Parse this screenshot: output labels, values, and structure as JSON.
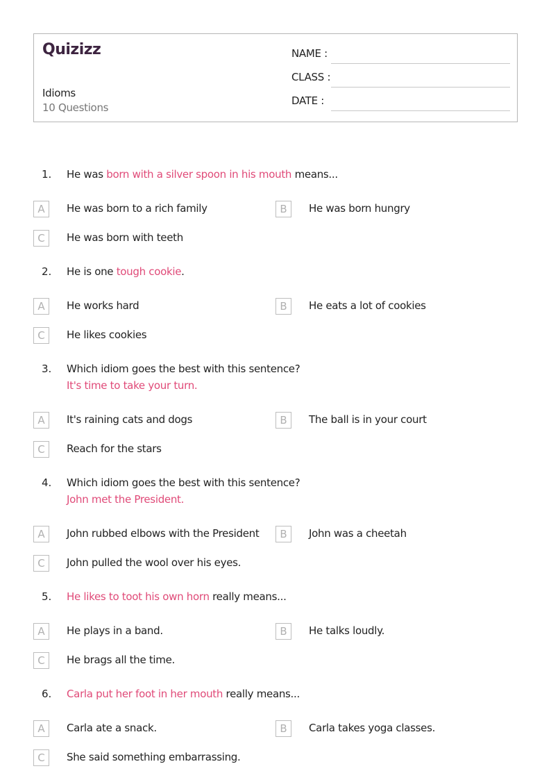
{
  "header": {
    "logo": "Quizizz",
    "title": "Idioms",
    "question_count": "10 Questions",
    "fields": {
      "name_label": "NAME :",
      "class_label": "CLASS :",
      "date_label": "DATE  :"
    }
  },
  "questions": [
    {
      "number": "1.",
      "parts": {
        "pre": "He was ",
        "highlight": "born with a silver spoon in his mouth",
        "post": " means..."
      },
      "options": [
        {
          "letter": "A",
          "text": "He was born to a rich family"
        },
        {
          "letter": "B",
          "text": "He was born hungry"
        },
        {
          "letter": "C",
          "text": "He was born with teeth"
        }
      ]
    },
    {
      "number": "2.",
      "parts": {
        "pre": "He is one ",
        "highlight": "tough cookie",
        "post": "."
      },
      "options": [
        {
          "letter": "A",
          "text": "He works hard"
        },
        {
          "letter": "B",
          "text": "He eats a lot of cookies"
        },
        {
          "letter": "C",
          "text": "He likes cookies"
        }
      ]
    },
    {
      "number": "3.",
      "text": "Which idiom goes the best with this sentence?",
      "sub": "It's time to take your turn.",
      "options": [
        {
          "letter": "A",
          "text": "It's raining cats and dogs"
        },
        {
          "letter": "B",
          "text": "The ball is in your court"
        },
        {
          "letter": "C",
          "text": "Reach for the stars"
        }
      ]
    },
    {
      "number": "4.",
      "text": "Which idiom goes the best with this sentence?",
      "sub": "John met the President.",
      "options": [
        {
          "letter": "A",
          "text": "John rubbed elbows with the President"
        },
        {
          "letter": "B",
          "text": "John was a cheetah"
        },
        {
          "letter": "C",
          "text": "John pulled the wool over his eyes."
        }
      ]
    },
    {
      "number": "5.",
      "parts": {
        "pre": "",
        "highlight": "He likes to toot his own horn",
        "post": " really means..."
      },
      "options": [
        {
          "letter": "A",
          "text": "He plays in a band."
        },
        {
          "letter": "B",
          "text": "He talks loudly."
        },
        {
          "letter": "C",
          "text": "He brags all the time."
        }
      ]
    },
    {
      "number": "6.",
      "parts": {
        "pre": "",
        "highlight": "Carla put her foot in her mouth",
        "post": " really means..."
      },
      "options": [
        {
          "letter": "A",
          "text": "Carla ate a snack."
        },
        {
          "letter": "B",
          "text": "Carla takes yoga classes."
        },
        {
          "letter": "C",
          "text": "She said something embarrassing."
        }
      ]
    }
  ],
  "colors": {
    "highlight": "#e04a78",
    "logo": "#3d2440",
    "text": "#222222",
    "muted": "#777777",
    "border": "#b5b5b5"
  }
}
